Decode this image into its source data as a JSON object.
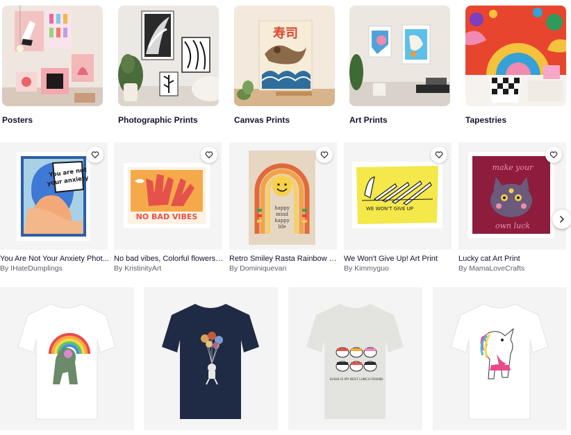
{
  "categories": [
    {
      "label": "Posters"
    },
    {
      "label": "Photographic Prints"
    },
    {
      "label": "Canvas Prints"
    },
    {
      "label": "Art Prints"
    },
    {
      "label": "Tapestries"
    }
  ],
  "art_products": [
    {
      "title": "You Are Not Your Anxiety Phot...",
      "artist": "By IHateDumplings",
      "art_text": "You are not your anxiety"
    },
    {
      "title": "No bad vibes, Colorful flowers, ...",
      "artist": "By KristinityArt",
      "art_text": "NO BAD VIBES"
    },
    {
      "title": "Retro Smiley Rasta Rainbow wit...",
      "artist": "By Dominiquevari",
      "art_text": "happy mind happy life"
    },
    {
      "title": "We Won't Give Up! Art Print",
      "artist": "By Kimmyguo",
      "art_text": "WE WON'T GIVE UP"
    },
    {
      "title": "Lucky cat Art Print",
      "artist": "By MamaLoveCrafts",
      "art_text": "make your own luck"
    }
  ],
  "tshirts": [
    {
      "shirt_color": "#ffffff"
    },
    {
      "shirt_color": "#1f2a44"
    },
    {
      "shirt_color": "#e3e3df"
    },
    {
      "shirt_color": "#ffffff"
    }
  ],
  "tshirt_text": {
    "sushi_caption": "SUSHI IS MY BEST LUNCH FRIEND"
  },
  "canvas_kanji": "寿司",
  "icons": {
    "favorite": "heart-icon",
    "next": "chevron-right-icon"
  }
}
